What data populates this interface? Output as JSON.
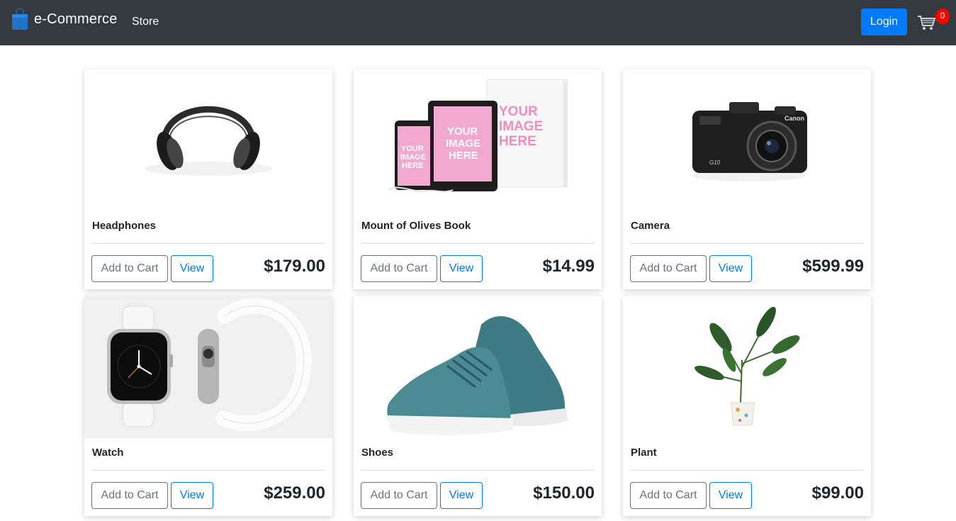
{
  "navbar": {
    "brand": "e-Commerce",
    "brand_icon": "shopping-bag-icon",
    "store_link": "Store",
    "login_label": "Login",
    "cart_icon": "cart-icon",
    "cart_count": "0"
  },
  "colors": {
    "navbar_bg": "#343a40",
    "primary": "#007bff",
    "secondary": "#6c757d",
    "badge": "#ff0000"
  },
  "products": [
    {
      "name": "Headphones",
      "price": "$179.00",
      "add_label": "Add to Cart",
      "view_label": "View",
      "image": "headphones"
    },
    {
      "name": "Mount of Olives Book",
      "price": "$14.99",
      "add_label": "Add to Cart",
      "view_label": "View",
      "image": "book-devices"
    },
    {
      "name": "Camera",
      "price": "$599.99",
      "add_label": "Add to Cart",
      "view_label": "View",
      "image": "camera"
    },
    {
      "name": "Watch",
      "price": "$259.00",
      "add_label": "Add to Cart",
      "view_label": "View",
      "image": "watch"
    },
    {
      "name": "Shoes",
      "price": "$150.00",
      "add_label": "Add to Cart",
      "view_label": "View",
      "image": "shoes"
    },
    {
      "name": "Plant",
      "price": "$99.00",
      "add_label": "Add to Cart",
      "view_label": "View",
      "image": "plant"
    }
  ]
}
